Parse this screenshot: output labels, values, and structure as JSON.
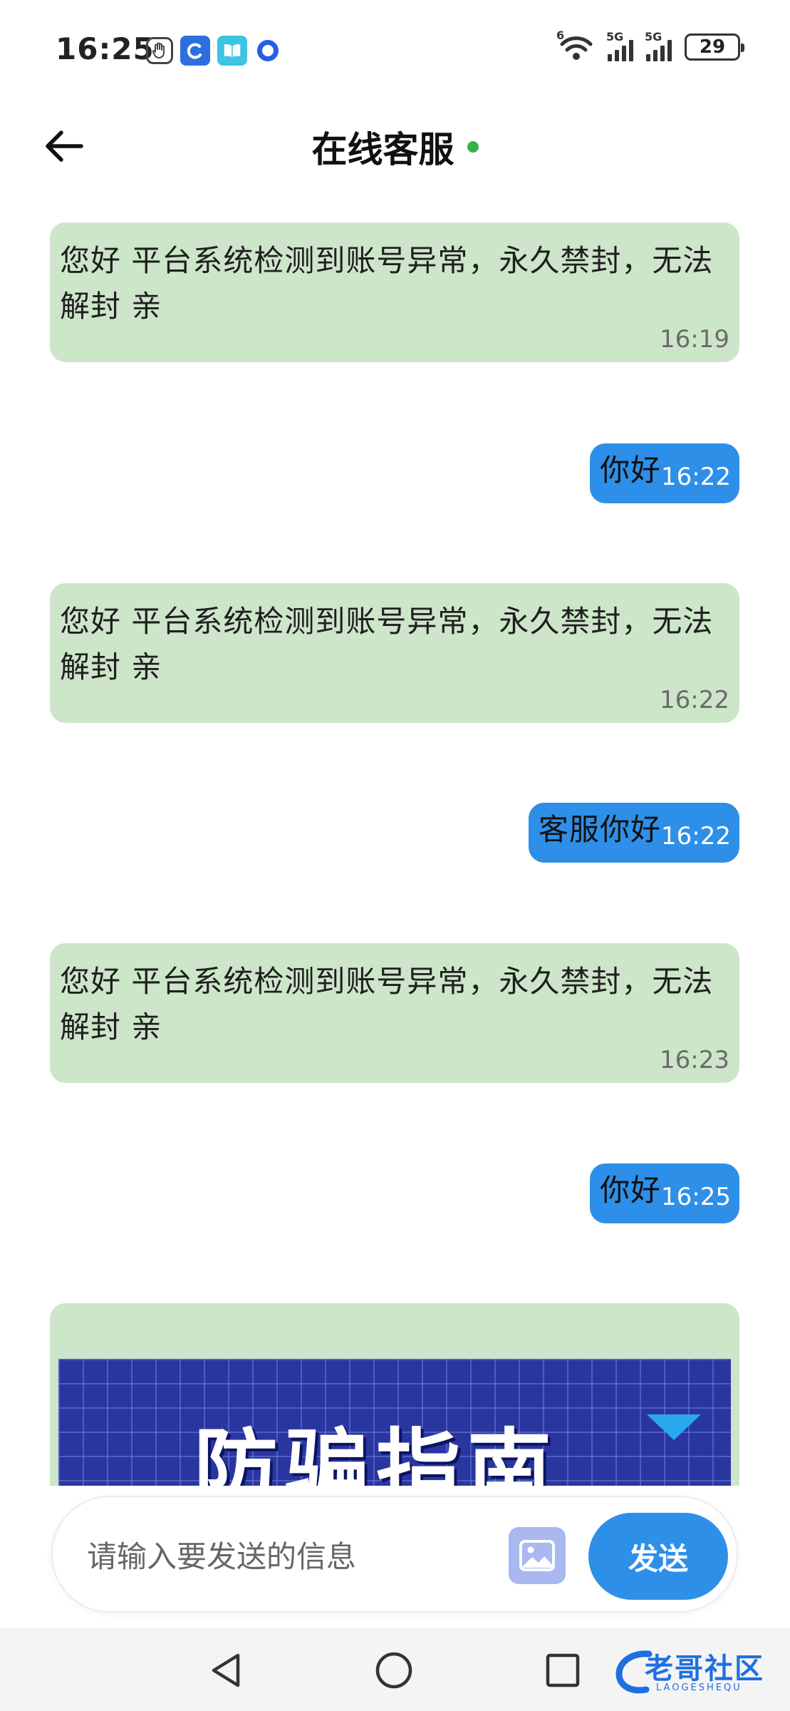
{
  "status_bar": {
    "time": "16:25",
    "battery": "29",
    "network_1": "5G",
    "network_2": "5G",
    "wifi_badge": "6"
  },
  "header": {
    "title": "在线客服",
    "online_color": "#35b34a"
  },
  "messages": [
    {
      "side": "in",
      "text": "您好  平台系统检测到账号异常，永久禁封，无法解封  亲",
      "time": "16:19"
    },
    {
      "side": "out",
      "text": "你好",
      "time": "16:22"
    },
    {
      "side": "in",
      "text": "您好  平台系统检测到账号异常，永久禁封，无法解封  亲",
      "time": "16:22"
    },
    {
      "side": "out",
      "text": "客服你好",
      "time": "16:22"
    },
    {
      "side": "in",
      "text": "您好  平台系统检测到账号异常，永久禁封，无法解封  亲",
      "time": "16:23"
    },
    {
      "side": "out",
      "text": "你好",
      "time": "16:25"
    }
  ],
  "banner": {
    "title": "防骗指南"
  },
  "composer": {
    "placeholder": "请输入要发送的信息",
    "send_label": "发送"
  },
  "watermark": {
    "text": "老哥社区",
    "sub": "LAOGESHEQU"
  },
  "colors": {
    "incoming_bubble": "#cde6c9",
    "outgoing_bubble": "#2e8fe8",
    "banner_bg": "#2a36a0"
  }
}
